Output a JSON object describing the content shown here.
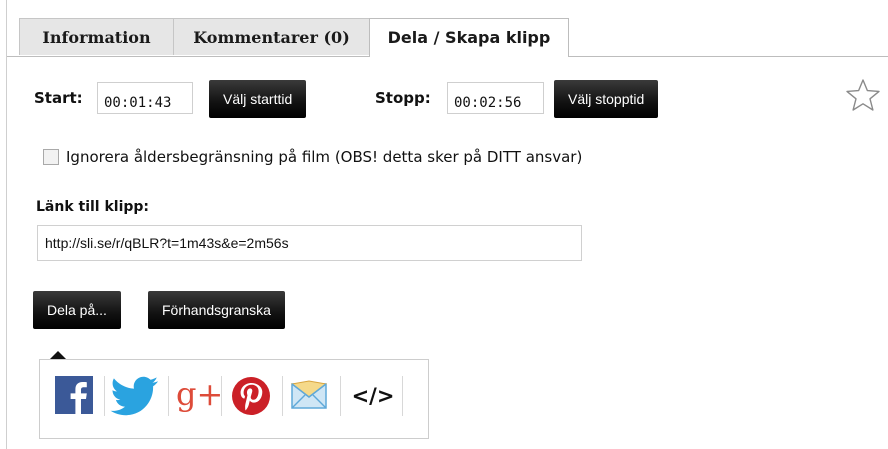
{
  "tabs": [
    {
      "label": "Information"
    },
    {
      "label": "Kommentarer (0)"
    },
    {
      "label": "Dela / Skapa klipp",
      "active": true
    }
  ],
  "clip": {
    "start_label": "Start:",
    "start_value": "00:01:43",
    "start_button": "Välj starttid",
    "stop_label": "Stopp:",
    "stop_value": "00:02:56",
    "stop_button": "Välj stopptid"
  },
  "age_restriction": {
    "label": "Ignorera åldersbegränsning på film (OBS! detta sker på DITT ansvar)",
    "checked": false
  },
  "link": {
    "label": "Länk till klipp:",
    "value": "http://sli.se/r/qBLR?t=1m43s&e=2m56s"
  },
  "actions": {
    "share_button": "Dela på...",
    "preview_button": "Förhandsgranska"
  },
  "share_icons": [
    {
      "name": "facebook-icon",
      "color": "#3b5998"
    },
    {
      "name": "twitter-icon",
      "color": "#2aa3e0"
    },
    {
      "name": "google-plus-icon",
      "color": "#dd4b39"
    },
    {
      "name": "pinterest-icon",
      "color": "#cb2027"
    },
    {
      "name": "email-icon",
      "color": "#5fa8d8"
    },
    {
      "name": "embed-code-icon",
      "color": "#111111"
    }
  ],
  "embed_glyph": "</>",
  "google_plus_glyph": "g+"
}
